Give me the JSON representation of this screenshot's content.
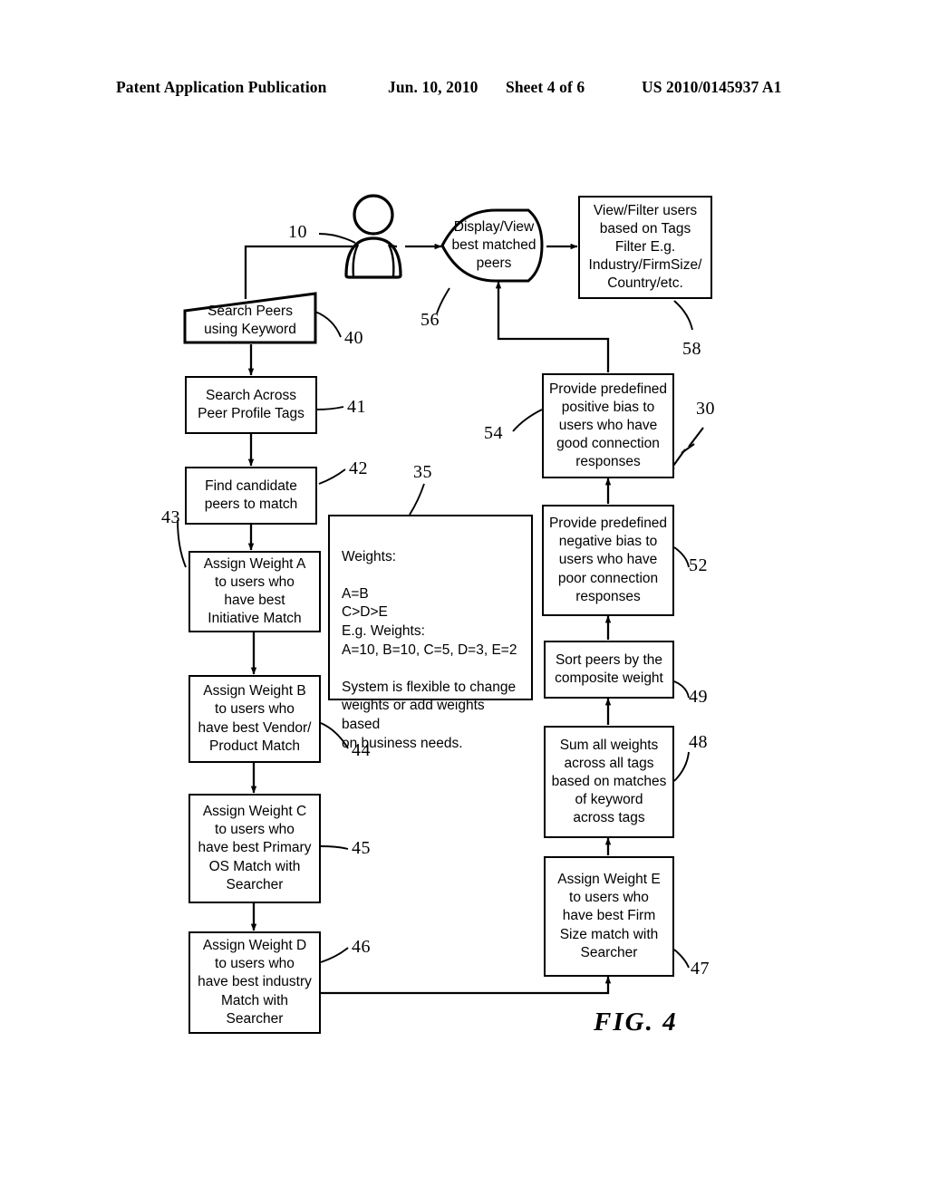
{
  "header": {
    "publication": "Patent Application Publication",
    "date": "Jun. 10, 2010",
    "sheet": "Sheet 4 of 6",
    "number": "US 2010/0145937 A1"
  },
  "figure": {
    "caption": "FIG.  4"
  },
  "nodes": {
    "user": {
      "ref": "10",
      "icon": "person-icon"
    },
    "search_peers": {
      "label": "Search Peers\nusing Keyword",
      "ref": "40"
    },
    "search_tags": {
      "label": "Search Across\nPeer Profile Tags",
      "ref": "41"
    },
    "find_candidates": {
      "label": "Find candidate\npeers to match",
      "ref": "42"
    },
    "weight_a": {
      "label": "Assign Weight A\nto users who\nhave best\nInitiative Match",
      "ref": "43"
    },
    "weight_b": {
      "label": "Assign Weight B\nto users who\nhave best Vendor/\nProduct Match",
      "ref": "44"
    },
    "weight_c": {
      "label": "Assign Weight C\nto users who\nhave best Primary\nOS Match with\nSearcher",
      "ref": "45"
    },
    "weight_d": {
      "label": "Assign Weight D\nto users who\nhave best industry\nMatch with\nSearcher",
      "ref": "46"
    },
    "weight_e": {
      "label": "Assign Weight E\nto users who\nhave best Firm\nSize match with\nSearcher",
      "ref": "47"
    },
    "sum_weights": {
      "label": "Sum all weights\nacross all tags\nbased on matches\nof keyword\nacross tags",
      "ref": "48"
    },
    "sort_peers": {
      "label": "Sort peers by the\ncomposite weight",
      "ref": "49"
    },
    "negative_bias": {
      "label": "Provide predefined\nnegative bias to\nusers who have\npoor connection\nresponses",
      "ref": "52"
    },
    "positive_bias": {
      "label": "Provide predefined\npositive bias to\nusers who have\ngood connection\nresponses",
      "ref": "54"
    },
    "display_view": {
      "label": "Display/View\nbest matched\npeers",
      "ref": "56"
    },
    "view_filter": {
      "label": "View/Filter users\nbased on Tags\nFilter E.g.\nIndustry/FirmSize/\nCountry/etc.",
      "ref": "58"
    },
    "weights_note": {
      "label": "Weights:\n\nA=B\nC>D>E\nE.g. Weights:\nA=10, B=10, C=5, D=3, E=2\n\nSystem is flexible to change\nweights or add weights based\non business needs.",
      "ref": "35"
    },
    "system_pointer": {
      "ref": "30"
    }
  },
  "colors": {
    "line": "#000000",
    "background": "#ffffff"
  }
}
